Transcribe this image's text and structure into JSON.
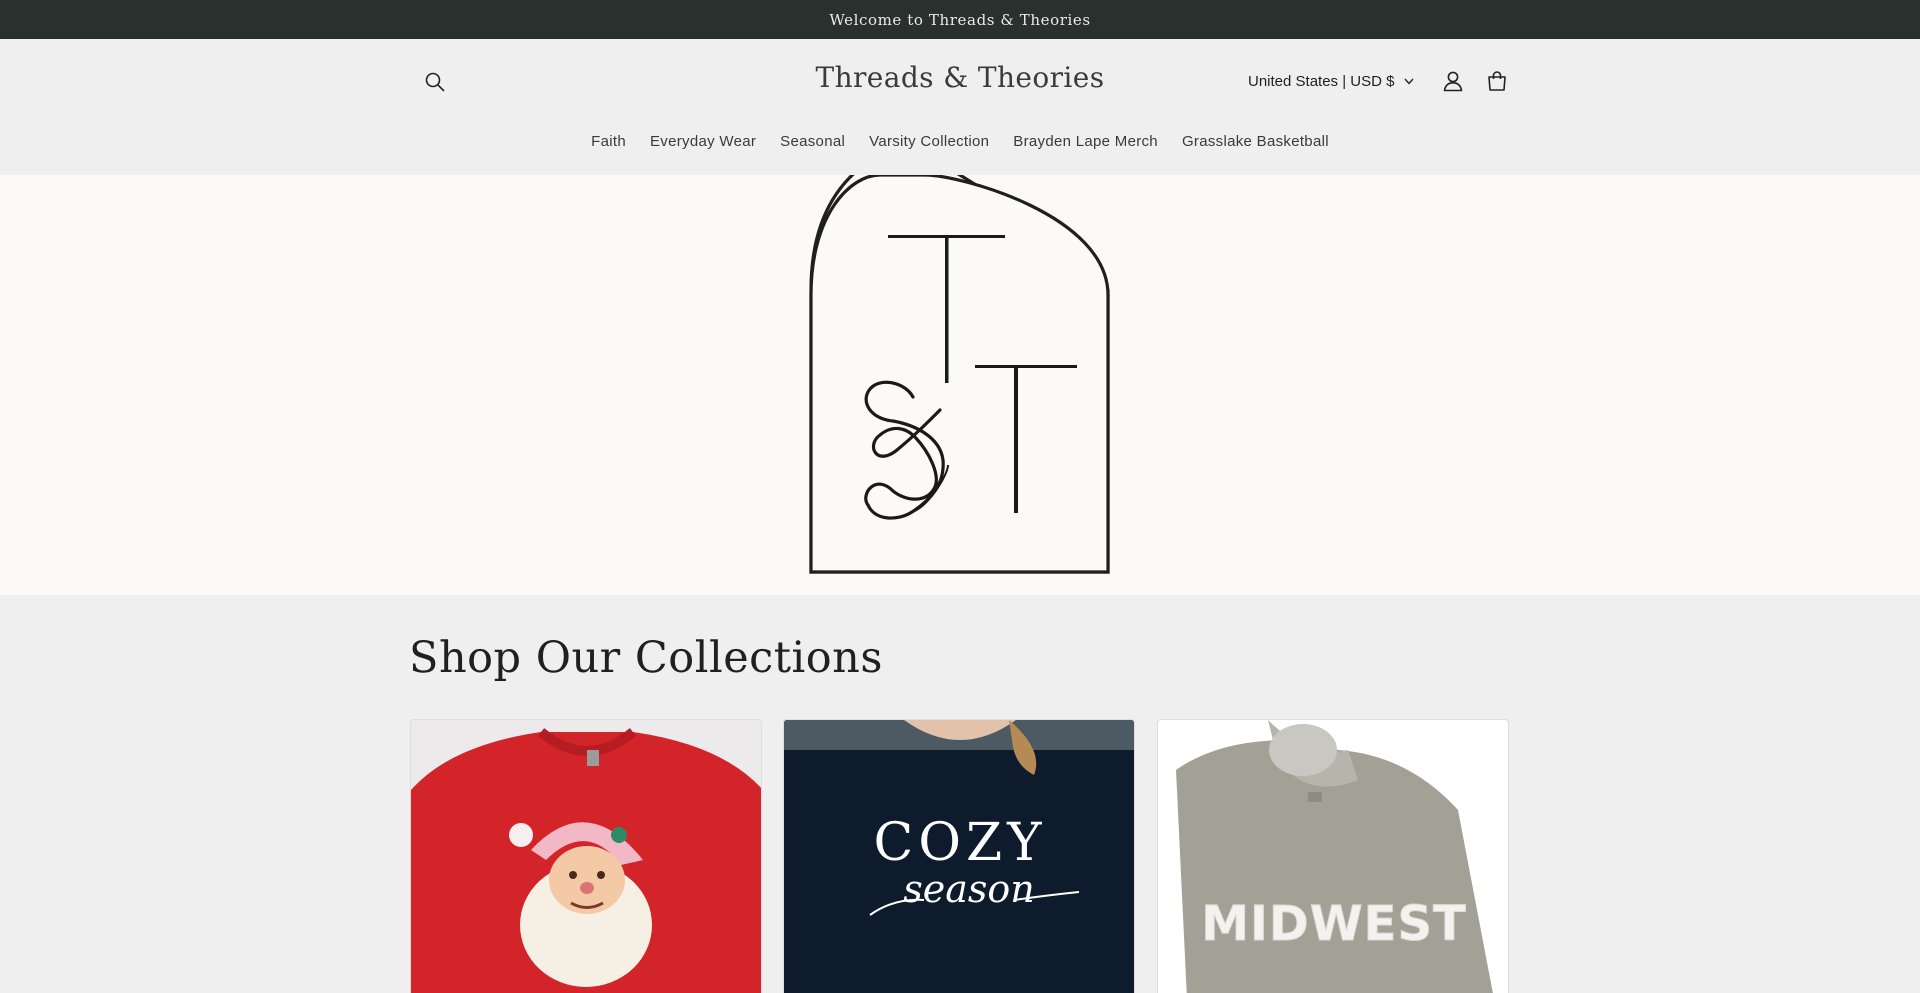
{
  "announcement": "Welcome to Threads & Theories",
  "header": {
    "brand": "Threads & Theories",
    "country_selector": "United States | USD $"
  },
  "nav": {
    "items": [
      {
        "label": "Faith"
      },
      {
        "label": "Everyday Wear"
      },
      {
        "label": "Seasonal"
      },
      {
        "label": "Varsity Collection"
      },
      {
        "label": "Brayden Lape Merch"
      },
      {
        "label": "Grasslake Basketball"
      }
    ]
  },
  "hero": {
    "logo_monogram": "T&T"
  },
  "collections": {
    "title": "Shop Our Collections",
    "cards": [
      {
        "image": "red sweatshirt with vintage Santa graphic"
      },
      {
        "image": "navy sweatshirt with cozy season print",
        "print_top": "COZY",
        "print_script": "season"
      },
      {
        "image": "gray sweatshirt with distressed midwest print",
        "print": "MIDWEST"
      }
    ]
  },
  "colors": {
    "announcement_bg": "#2a302d",
    "page_bg": "#f0eff0",
    "hero_bg": "#fbfaf7"
  }
}
